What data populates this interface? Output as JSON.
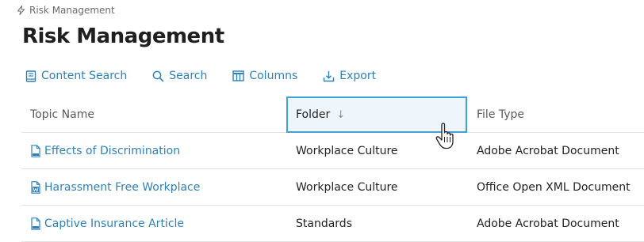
{
  "breadcrumb": {
    "icon": "lightning-icon",
    "label": "Risk Management"
  },
  "page_title": "Risk Management",
  "toolbar": {
    "content_search": {
      "label": "Content Search",
      "icon": "book-icon"
    },
    "search": {
      "label": "Search",
      "icon": "search-icon"
    },
    "columns": {
      "label": "Columns",
      "icon": "columns-icon"
    },
    "export": {
      "label": "Export",
      "icon": "export-icon"
    }
  },
  "columns": {
    "topic_name": "Topic Name",
    "folder": "Folder",
    "folder_sort": "↓",
    "file_type": "File Type"
  },
  "rows": [
    {
      "topic": "Effects of Discrimination",
      "icon": "pdf-file-icon",
      "folder": "Workplace Culture",
      "file_type": "Adobe Acrobat Document"
    },
    {
      "topic": "Harassment Free Workplace",
      "icon": "word-file-icon",
      "folder": "Workplace Culture",
      "file_type": "Office Open XML Document"
    },
    {
      "topic": "Captive Insurance Article",
      "icon": "pdf-file-icon",
      "folder": "Standards",
      "file_type": "Adobe Acrobat Document"
    }
  ],
  "colors": {
    "accent": "#2f80b8",
    "header_highlight_border": "#3ea3dc",
    "header_highlight_bg": "#eef6fc"
  }
}
